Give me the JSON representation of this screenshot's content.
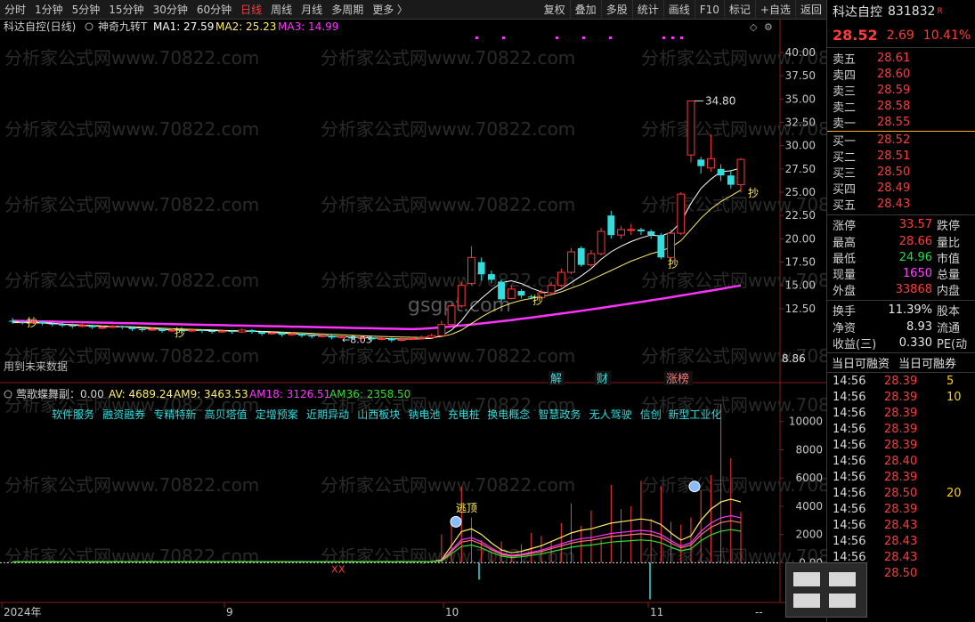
{
  "toolbar": {
    "periods": [
      "分时",
      "1分钟",
      "5分钟",
      "15分钟",
      "30分钟",
      "60分钟",
      "日线",
      "周线",
      "月线",
      "多周期",
      "更多 〉"
    ],
    "active_period": "日线",
    "actions": [
      "复权",
      "叠加",
      "多股",
      "统计",
      "画线",
      "F10",
      "标记",
      "+自选",
      "返回"
    ]
  },
  "chart_header": {
    "stock": "科达自控(日线)",
    "indicator": "神奇九转T",
    "ma1_label": "MA1: 27.59",
    "ma2_label": "MA2: 25.23",
    "ma3_label": "MA3: 14.99"
  },
  "watermark": "分析家公式网www.70822.com",
  "watermark2": "gsgpt.com",
  "future_data_note": "用到未来数据",
  "low_label": "8.86",
  "bottom_small_label": "8.03",
  "high_label": "34.80",
  "buy_mark": "抄",
  "event_marks": [
    "解",
    "财",
    "涨榜"
  ],
  "sub_header": {
    "name": "莺歌蝶舞副：0.00",
    "av": "AV: 4689.24",
    "am9": "AM9: 3463.53",
    "am18": "AM18: 3126.51",
    "am36": "AM36: 2358.50"
  },
  "concepts": [
    "软件服务",
    "融资融券",
    "专精特新",
    "高贝塔值",
    "定增预案",
    "近期异动",
    "山西板块",
    "钠电池",
    "充电桩",
    "换电概念",
    "智慧政务",
    "无人驾驶",
    "信创",
    "新型工业化"
  ],
  "top_label": "逃顶",
  "x_axis": [
    "2024年",
    "9",
    "10",
    "11"
  ],
  "x_axis_end": "--",
  "colors": {
    "up": "#ff3b3b",
    "down": "#33dddd",
    "ma1": "#ffffff",
    "ma2": "#ffee66",
    "ma3": "#ff33ff",
    "am9": "#ff33ff",
    "am36": "#33dd33"
  },
  "chart_data": [
    {
      "type": "candlestick",
      "title": "科达自控(日线)",
      "ylim": [
        8,
        42
      ],
      "y_ticks": [
        12.5,
        15.0,
        17.5,
        20.0,
        22.5,
        25.0,
        27.5,
        30.0,
        32.5,
        35.0,
        37.5,
        40.0
      ],
      "candles": [
        {
          "o": 11.2,
          "c": 11.1,
          "h": 11.5,
          "l": 10.9
        },
        {
          "o": 11.1,
          "c": 11.0,
          "h": 11.3,
          "l": 10.8
        },
        {
          "o": 11.0,
          "c": 11.1,
          "h": 11.3,
          "l": 10.9
        },
        {
          "o": 11.1,
          "c": 10.9,
          "h": 11.2,
          "l": 10.7
        },
        {
          "o": 10.9,
          "c": 10.8,
          "h": 11.0,
          "l": 10.6
        },
        {
          "o": 10.8,
          "c": 10.7,
          "h": 11.0,
          "l": 10.5
        },
        {
          "o": 10.7,
          "c": 10.6,
          "h": 10.9,
          "l": 10.4
        },
        {
          "o": 10.6,
          "c": 10.7,
          "h": 10.9,
          "l": 10.5
        },
        {
          "o": 10.7,
          "c": 10.5,
          "h": 10.8,
          "l": 10.3
        },
        {
          "o": 10.5,
          "c": 10.5,
          "h": 10.7,
          "l": 10.3
        },
        {
          "o": 10.5,
          "c": 10.6,
          "h": 10.8,
          "l": 10.4
        },
        {
          "o": 10.6,
          "c": 10.5,
          "h": 10.7,
          "l": 10.3
        },
        {
          "o": 10.5,
          "c": 10.3,
          "h": 10.6,
          "l": 10.1
        },
        {
          "o": 10.3,
          "c": 10.2,
          "h": 10.5,
          "l": 10.0
        },
        {
          "o": 10.2,
          "c": 10.3,
          "h": 10.5,
          "l": 10.1
        },
        {
          "o": 10.3,
          "c": 10.1,
          "h": 10.4,
          "l": 9.9
        },
        {
          "o": 10.1,
          "c": 10.2,
          "h": 10.4,
          "l": 10.0
        },
        {
          "o": 10.2,
          "c": 10.1,
          "h": 10.3,
          "l": 9.9
        },
        {
          "o": 10.1,
          "c": 10.2,
          "h": 10.4,
          "l": 10.0
        },
        {
          "o": 10.2,
          "c": 10.1,
          "h": 10.3,
          "l": 9.9
        },
        {
          "o": 10.1,
          "c": 10.0,
          "h": 10.2,
          "l": 9.8
        },
        {
          "o": 10.0,
          "c": 10.1,
          "h": 10.3,
          "l": 9.9
        },
        {
          "o": 10.1,
          "c": 10.0,
          "h": 10.2,
          "l": 9.8
        },
        {
          "o": 10.0,
          "c": 10.2,
          "h": 10.4,
          "l": 9.9
        },
        {
          "o": 10.2,
          "c": 10.0,
          "h": 10.3,
          "l": 9.8
        },
        {
          "o": 10.0,
          "c": 9.8,
          "h": 10.1,
          "l": 9.6
        },
        {
          "o": 9.8,
          "c": 9.9,
          "h": 10.1,
          "l": 9.7
        },
        {
          "o": 9.9,
          "c": 9.7,
          "h": 10.0,
          "l": 9.5
        },
        {
          "o": 9.7,
          "c": 9.8,
          "h": 10.0,
          "l": 9.6
        },
        {
          "o": 9.8,
          "c": 9.6,
          "h": 9.9,
          "l": 9.4
        },
        {
          "o": 9.6,
          "c": 9.5,
          "h": 9.7,
          "l": 9.3
        },
        {
          "o": 9.5,
          "c": 9.6,
          "h": 9.8,
          "l": 9.4
        },
        {
          "o": 9.6,
          "c": 9.4,
          "h": 9.7,
          "l": 9.2
        },
        {
          "o": 9.4,
          "c": 9.5,
          "h": 9.7,
          "l": 9.3
        },
        {
          "o": 9.5,
          "c": 9.3,
          "h": 9.6,
          "l": 9.1
        },
        {
          "o": 9.3,
          "c": 9.4,
          "h": 9.6,
          "l": 9.2
        },
        {
          "o": 9.4,
          "c": 9.2,
          "h": 9.5,
          "l": 9.0
        },
        {
          "o": 9.2,
          "c": 9.3,
          "h": 9.5,
          "l": 9.1
        },
        {
          "o": 9.3,
          "c": 9.1,
          "h": 9.4,
          "l": 8.9
        },
        {
          "o": 9.1,
          "c": 9.2,
          "h": 9.4,
          "l": 9.0
        },
        {
          "o": 9.2,
          "c": 9.3,
          "h": 9.5,
          "l": 9.1
        },
        {
          "o": 9.3,
          "c": 9.4,
          "h": 9.6,
          "l": 9.2
        },
        {
          "o": 9.4,
          "c": 9.6,
          "h": 9.8,
          "l": 9.3
        },
        {
          "o": 9.6,
          "c": 10.8,
          "h": 11.2,
          "l": 9.5
        },
        {
          "o": 10.8,
          "c": 12.8,
          "h": 13.0,
          "l": 10.7
        },
        {
          "o": 12.8,
          "c": 15.0,
          "h": 15.4,
          "l": 12.6
        },
        {
          "o": 15.2,
          "c": 18.0,
          "h": 19.2,
          "l": 15.0
        },
        {
          "o": 17.5,
          "c": 16.2,
          "h": 18.0,
          "l": 15.5
        },
        {
          "o": 16.2,
          "c": 15.6,
          "h": 16.6,
          "l": 15.2
        },
        {
          "o": 15.4,
          "c": 13.5,
          "h": 15.6,
          "l": 13.2
        },
        {
          "o": 13.6,
          "c": 14.6,
          "h": 15.0,
          "l": 13.5
        },
        {
          "o": 14.4,
          "c": 13.9,
          "h": 14.6,
          "l": 13.6
        },
        {
          "o": 13.8,
          "c": 13.7,
          "h": 14.0,
          "l": 13.5
        },
        {
          "o": 13.7,
          "c": 14.2,
          "h": 14.6,
          "l": 13.6
        },
        {
          "o": 14.2,
          "c": 15.0,
          "h": 15.4,
          "l": 14.0
        },
        {
          "o": 15.0,
          "c": 16.4,
          "h": 16.8,
          "l": 14.8
        },
        {
          "o": 16.4,
          "c": 18.6,
          "h": 19.0,
          "l": 16.2
        },
        {
          "o": 19.0,
          "c": 17.2,
          "h": 19.2,
          "l": 17.0
        },
        {
          "o": 17.2,
          "c": 18.4,
          "h": 18.8,
          "l": 17.0
        },
        {
          "o": 18.4,
          "c": 20.8,
          "h": 21.2,
          "l": 18.2
        },
        {
          "o": 22.5,
          "c": 20.4,
          "h": 23.0,
          "l": 20.0
        },
        {
          "o": 20.4,
          "c": 21.0,
          "h": 21.4,
          "l": 20.0
        },
        {
          "o": 21.0,
          "c": 21.0,
          "h": 21.6,
          "l": 20.4
        },
        {
          "o": 21.0,
          "c": 20.8,
          "h": 21.2,
          "l": 20.4
        },
        {
          "o": 20.8,
          "c": 20.4,
          "h": 21.0,
          "l": 20.0
        },
        {
          "o": 20.4,
          "c": 18.0,
          "h": 20.6,
          "l": 17.8
        },
        {
          "o": 18.0,
          "c": 20.6,
          "h": 21.0,
          "l": 17.6
        },
        {
          "o": 20.6,
          "c": 24.8,
          "h": 25.0,
          "l": 20.4
        },
        {
          "o": 29.0,
          "c": 34.8,
          "h": 34.8,
          "l": 28.2
        },
        {
          "o": 28.5,
          "c": 27.8,
          "h": 28.8,
          "l": 27.0
        },
        {
          "o": 27.6,
          "c": 28.6,
          "h": 31.2,
          "l": 27.2
        },
        {
          "o": 27.5,
          "c": 26.8,
          "h": 28.0,
          "l": 26.2
        },
        {
          "o": 26.8,
          "c": 25.8,
          "h": 27.4,
          "l": 25.4
        },
        {
          "o": 25.8,
          "c": 28.52,
          "h": 28.66,
          "l": 24.96
        }
      ],
      "ma1": [
        11.1,
        11.05,
        11.05,
        11.0,
        10.95,
        10.85,
        10.75,
        10.7,
        10.65,
        10.6,
        10.57,
        10.55,
        10.5,
        10.42,
        10.35,
        10.28,
        10.22,
        10.2,
        10.18,
        10.17,
        10.15,
        10.12,
        10.1,
        10.08,
        10.07,
        10.02,
        9.96,
        9.88,
        9.82,
        9.76,
        9.69,
        9.63,
        9.56,
        9.5,
        9.45,
        9.4,
        9.36,
        9.32,
        9.28,
        9.24,
        9.24,
        9.26,
        9.3,
        9.6,
        10.2,
        11.2,
        12.6,
        13.6,
        14.5,
        15.3,
        15.5,
        15.2,
        14.7,
        14.3,
        14.2,
        14.6,
        15.3,
        16.0,
        16.8,
        17.8,
        18.6,
        19.2,
        19.7,
        20.1,
        20.4,
        20.3,
        20.7,
        21.8,
        23.8,
        25.4,
        26.4,
        27.2,
        27.3,
        27.59
      ],
      "ma2": [
        11.0,
        11.0,
        10.98,
        10.95,
        10.9,
        10.85,
        10.8,
        10.75,
        10.7,
        10.65,
        10.62,
        10.58,
        10.55,
        10.5,
        10.45,
        10.4,
        10.35,
        10.32,
        10.28,
        10.25,
        10.22,
        10.18,
        10.15,
        10.12,
        10.1,
        10.06,
        10.02,
        9.98,
        9.94,
        9.9,
        9.85,
        9.8,
        9.75,
        9.7,
        9.65,
        9.6,
        9.56,
        9.52,
        9.48,
        9.45,
        9.43,
        9.42,
        9.43,
        9.5,
        9.75,
        10.2,
        10.9,
        11.6,
        12.2,
        12.7,
        13.1,
        13.4,
        13.6,
        13.8,
        14.0,
        14.3,
        14.7,
        15.1,
        15.6,
        16.1,
        16.6,
        17.1,
        17.6,
        18.0,
        18.4,
        18.7,
        19.1,
        19.8,
        21.0,
        22.2,
        23.2,
        24.0,
        24.6,
        25.23
      ],
      "ma3_start": 11.2,
      "ma3_end": 14.99
    },
    {
      "type": "bar",
      "title": "莺歌蝶舞副",
      "ylim": [
        -2500,
        12000
      ],
      "y_ticks": [
        0,
        2000,
        4000,
        6000,
        8000,
        10000
      ]
    }
  ],
  "right_panel": {
    "name": "科达自控",
    "code": "831832",
    "badge": "R",
    "last": "28.52",
    "change": "2.69",
    "pct": "10.41%",
    "asks": [
      {
        "label": "卖五",
        "price": "28.61"
      },
      {
        "label": "卖四",
        "price": "28.60"
      },
      {
        "label": "卖三",
        "price": "28.59"
      },
      {
        "label": "卖二",
        "price": "28.58"
      },
      {
        "label": "卖一",
        "price": "28.55"
      }
    ],
    "bids": [
      {
        "label": "买一",
        "price": "28.52"
      },
      {
        "label": "买二",
        "price": "28.51"
      },
      {
        "label": "买三",
        "price": "28.50"
      },
      {
        "label": "买四",
        "price": "28.49"
      },
      {
        "label": "买五",
        "price": "28.43"
      }
    ],
    "stats1": [
      {
        "label": "涨停",
        "value": "33.57",
        "cls": "red",
        "label2": "跌停"
      },
      {
        "label": "最高",
        "value": "28.66",
        "cls": "red",
        "label2": "量比"
      },
      {
        "label": "最低",
        "value": "24.96",
        "cls": "green",
        "label2": "市值"
      },
      {
        "label": "现量",
        "value": "1650",
        "cls": "magenta",
        "label2": "总量"
      },
      {
        "label": "外盘",
        "value": "33868",
        "cls": "red",
        "label2": "内盘"
      }
    ],
    "stats2": [
      {
        "label": "换手",
        "value": "11.39%",
        "cls": "white",
        "label2": "股本"
      },
      {
        "label": "净资",
        "value": "8.93",
        "cls": "white",
        "label2": "流通"
      },
      {
        "label": "收益(三)",
        "value": "0.330",
        "cls": "white",
        "label2": "PE(动"
      }
    ],
    "tabs": [
      "当日可融资",
      "当日可融券"
    ],
    "ticks": [
      {
        "time": "14:56",
        "price": "28.39",
        "vol": "5"
      },
      {
        "time": "14:56",
        "price": "28.39",
        "vol": "10"
      },
      {
        "time": "14:56",
        "price": "28.39",
        "vol": ""
      },
      {
        "time": "14:56",
        "price": "28.39",
        "vol": ""
      },
      {
        "time": "14:56",
        "price": "28.39",
        "vol": ""
      },
      {
        "time": "14:56",
        "price": "28.40",
        "vol": ""
      },
      {
        "time": "14:56",
        "price": "28.39",
        "vol": ""
      },
      {
        "time": "14:56",
        "price": "28.50",
        "vol": "20"
      },
      {
        "time": "14:56",
        "price": "28.39",
        "vol": ""
      },
      {
        "time": "14:56",
        "price": "28.43",
        "vol": ""
      },
      {
        "time": "14:56",
        "price": "28.43",
        "vol": ""
      },
      {
        "time": "14:56",
        "price": "28.43",
        "vol": ""
      },
      {
        "time": "14:56",
        "price": "28.50",
        "vol": ""
      }
    ]
  }
}
